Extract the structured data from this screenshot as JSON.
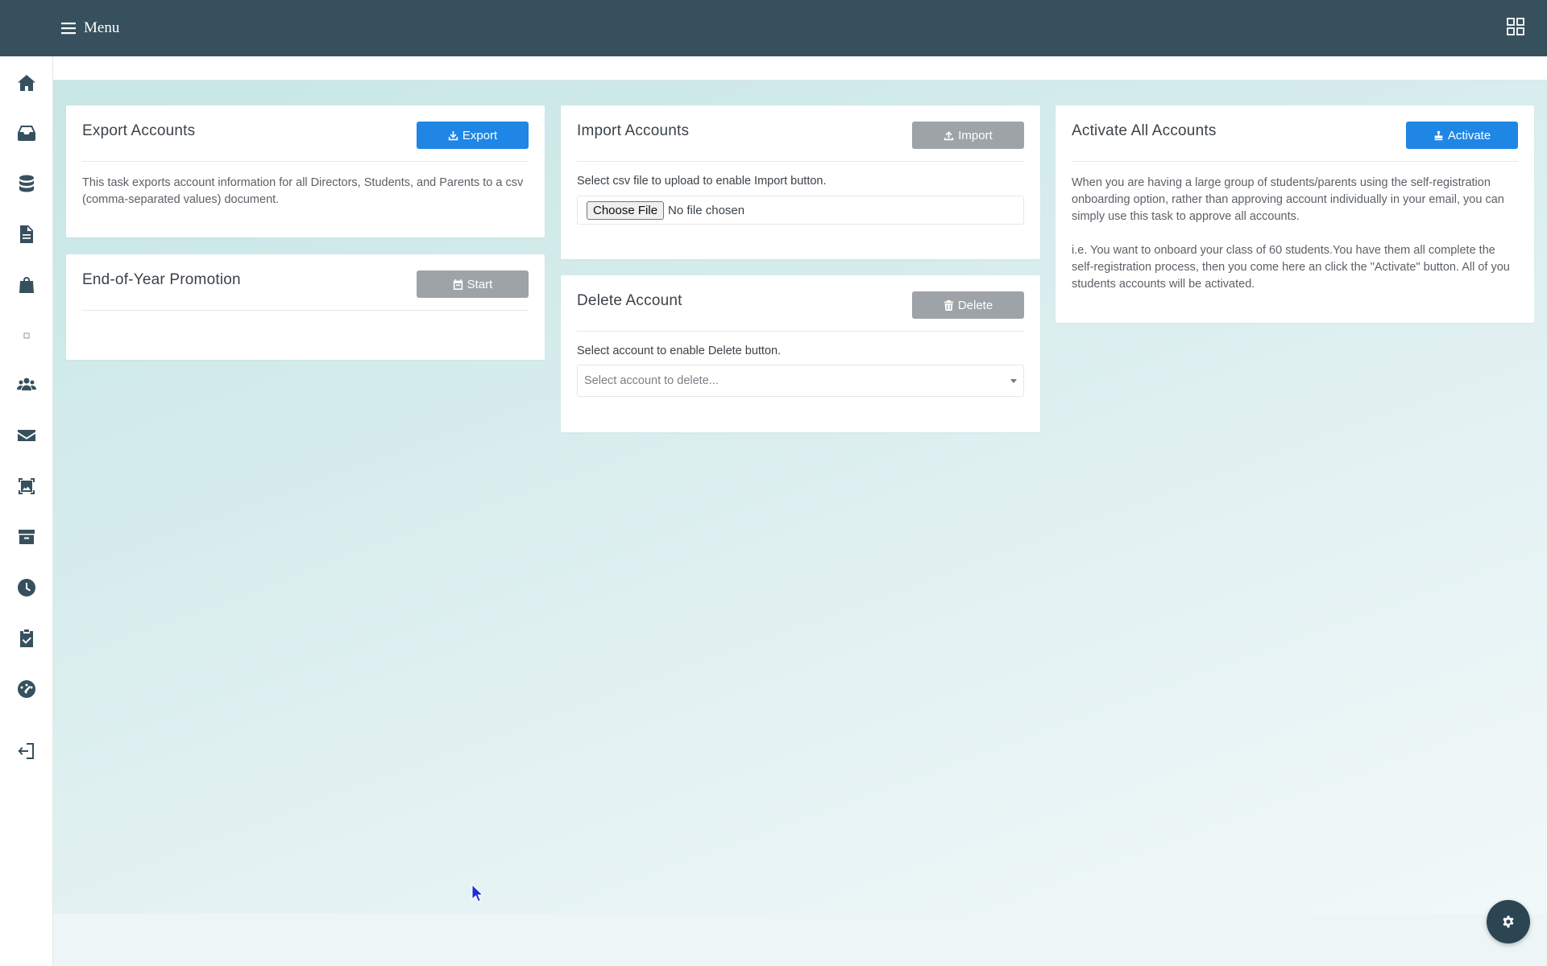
{
  "topbar": {
    "menu_label": "Menu",
    "apps_icon": "grid-icon"
  },
  "sidebar": {
    "items": [
      {
        "name": "home",
        "icon": "home-icon"
      },
      {
        "name": "inbox",
        "icon": "inbox-icon"
      },
      {
        "name": "database",
        "icon": "database-icon"
      },
      {
        "name": "documents",
        "icon": "document-icon"
      },
      {
        "name": "shop",
        "icon": "shopping-bag-icon"
      },
      {
        "name": "blank",
        "icon": "square-icon"
      },
      {
        "name": "users",
        "icon": "users-icon"
      },
      {
        "name": "mail",
        "icon": "envelope-icon"
      },
      {
        "name": "gallery",
        "icon": "image-frame-icon"
      },
      {
        "name": "archive",
        "icon": "archive-icon"
      },
      {
        "name": "history",
        "icon": "clock-icon"
      },
      {
        "name": "tasks",
        "icon": "clipboard-check-icon"
      },
      {
        "name": "dashboard",
        "icon": "gauge-icon"
      },
      {
        "name": "logout",
        "icon": "sign-out-icon"
      }
    ]
  },
  "cards": {
    "export": {
      "title": "Export Accounts",
      "button_label": "Export",
      "description": "This task exports account information for all Directors, Students, and Parents to a csv (comma-separated values) document."
    },
    "promotion": {
      "title": "End-of-Year Promotion",
      "button_label": "Start"
    },
    "import": {
      "title": "Import Accounts",
      "button_label": "Import",
      "instruction": "Select csv file to upload to enable Import button.",
      "choose_file_label": "Choose File",
      "file_status": "No file chosen"
    },
    "delete": {
      "title": "Delete Account",
      "button_label": "Delete",
      "instruction": "Select account to enable Delete button.",
      "select_placeholder": "Select account to delete..."
    },
    "activate": {
      "title": "Activate All Accounts",
      "button_label": "Activate",
      "paragraph1": "When you are having a large group of students/parents using the self-registration onboarding option, rather than approving account individually in your email, you can simply use this task to approve all accounts.",
      "paragraph2": "i.e. You want to onboard your class of 60 students.You have them all complete the self-registration process, then you come here an click the \"Activate\" button. All of you students accounts will be activated."
    }
  },
  "colors": {
    "topbar": "#37505d",
    "primary_button": "#1f86e5",
    "disabled_button": "#9ea3a8",
    "fab": "#2b4553"
  },
  "fab_icon": "gear-icon"
}
